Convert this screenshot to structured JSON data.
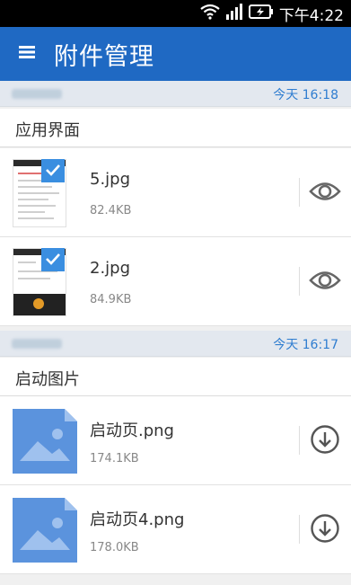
{
  "status_bar": {
    "time": "下午4:22"
  },
  "app_bar": {
    "title": "附件管理"
  },
  "groups": [
    {
      "time": "今天 16:18",
      "section_title": "应用界面",
      "files": [
        {
          "name": "5.jpg",
          "size": "82.4KB",
          "action": "eye-icon"
        },
        {
          "name": "2.jpg",
          "size": "84.9KB",
          "action": "eye-icon"
        }
      ]
    },
    {
      "time": "今天 16:17",
      "section_title": "启动图片",
      "files": [
        {
          "name": "启动页.png",
          "size": "174.1KB",
          "action": "download-icon"
        },
        {
          "name": "启动页4.png",
          "size": "178.0KB",
          "action": "download-icon"
        }
      ]
    }
  ],
  "colors": {
    "app_bar": "#1f69c3",
    "accent": "#2f7dd0",
    "image_placeholder": "#5b93dd"
  }
}
